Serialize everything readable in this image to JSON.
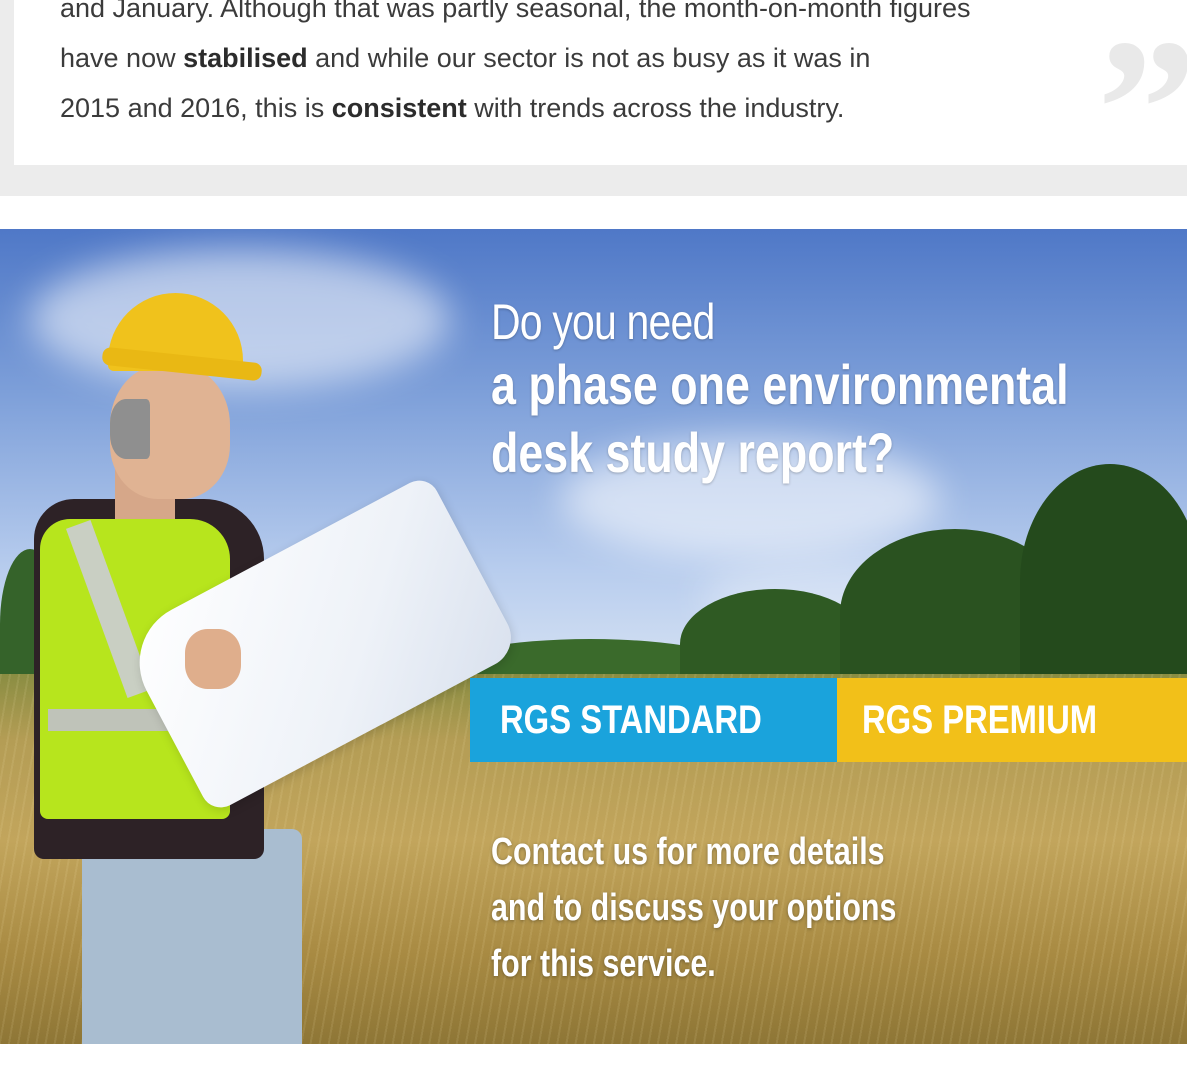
{
  "quote": {
    "line1": "and January. Although that was partly seasonal, the month-on-month figures",
    "line2_pre": "have now ",
    "line2_bold": "stabilised",
    "line2_post": " and while our sector is not as busy as it was in",
    "line3_pre": "2015 and 2016, this is ",
    "line3_bold": "consistent",
    "line3_post": " with trends across the industry.",
    "mark": "”"
  },
  "banner": {
    "headline_light": "Do you need",
    "headline_bold_1": "a phase one environmental",
    "headline_bold_2": "desk study report?",
    "buttons": {
      "standard": "RGS STANDARD",
      "premium": "RGS PREMIUM"
    },
    "contact_1": "Contact us for more details",
    "contact_2": "and to discuss your options",
    "contact_3": "for this service.",
    "colors": {
      "standard": "#1aa3dc",
      "premium": "#f2c019"
    }
  }
}
